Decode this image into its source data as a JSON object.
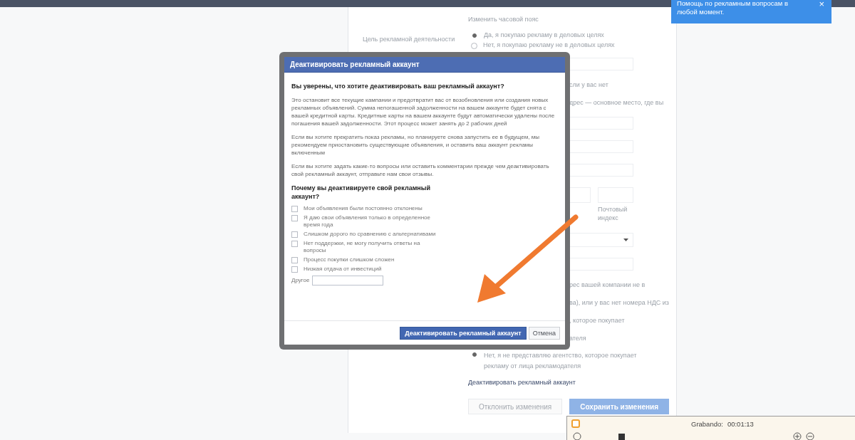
{
  "help_tooltip": {
    "text": "Помощь по рекламным вопросам в любой момент.",
    "close": "×"
  },
  "form": {
    "timezone_link": "Изменить часовой пояс",
    "purpose": {
      "label": "Цель рекламной деятельности",
      "options": [
        {
          "label": "Да, я покупаю рекламу в деловых целях",
          "selected": true
        },
        {
          "label": "Нет, я покупаю рекламу не в деловых целях",
          "selected": false
        }
      ]
    },
    "rows": [
      {
        "kind": "field"
      },
      {
        "kind": "note",
        "text": "сли у вас нет"
      },
      {
        "kind": "note",
        "text": "дрес — основное место, где вы"
      },
      {
        "kind": "field"
      },
      {
        "kind": "field"
      },
      {
        "kind": "field"
      },
      {
        "kind": "postal",
        "label": "Почтовый индекс"
      },
      {
        "kind": "select"
      },
      {
        "kind": "field"
      },
      {
        "kind": "note",
        "text": "рес вашей компании не в"
      },
      {
        "kind": "note",
        "text": "ва), или у вас нет номера НДС из"
      },
      {
        "kind": "note",
        "text": ", которое покупает"
      },
      {
        "kind": "note",
        "text": "ателя"
      }
    ],
    "agency_option": {
      "label": "Нет, я не представляю агентство, которое покупает рекламу от лица рекламодателя",
      "selected": true
    },
    "deactivate_link": "Деактивировать рекламный аккаунт",
    "buttons": [
      {
        "label": "Отклонить изменения",
        "disabled": true
      },
      {
        "label": "Сохранить изменения",
        "disabled": false
      }
    ]
  },
  "dialog": {
    "title": "Деактивировать рекламный аккаунт",
    "question": "Вы уверены, что хотите деактивировать ваш рекламный аккаунт?",
    "paragraphs": [
      "Это остановит все текущие кампании и предотвратит вас от возобновления или создания новых рекламных объявлений. Сумма непогашенной задолженности на вашем аккаунте будет снята с вашей кредитной карты. Кредитные карты на вашем аккаунте будут автоматически удалены после погашения вашей задолженности. Этот процесс может занять до 2 рабочих дней",
      "Если вы хотите прекратить показ рекламы, но планируете снова запустить ее в будущем, мы рекомендуем приостановить существующие объявления, и оставить ваш аккаунт рекламы включенным",
      "Если вы хотите задать какие-то вопросы или оставить комментарии прежде чем деактивировать свой рекламный аккаунт, отправьте нам свои отзывы."
    ],
    "reasons_title": "Почему вы деактивируете свой рекламный аккаунт?",
    "reasons": [
      {
        "label": "Мои объявления были постоянно отклонены",
        "checked": false
      },
      {
        "label": "Я даю свои объявления только в определенное время года",
        "checked": false
      },
      {
        "label": "Слишком дорого по сравнению с альтернативами",
        "checked": false
      },
      {
        "label": "Нет поддержки, не могу получить ответы на вопросы",
        "checked": false
      },
      {
        "label": "Процесс покупки слишком сложен",
        "checked": false
      },
      {
        "label": "Низкая отдача от инвестиций",
        "checked": false
      }
    ],
    "other_label": "Другое",
    "confirm_button": "Деактивировать рекламный аккаунт",
    "cancel_button": "Отмена"
  },
  "recorder": {
    "label": "Grabando:",
    "time": "00:01:13"
  }
}
